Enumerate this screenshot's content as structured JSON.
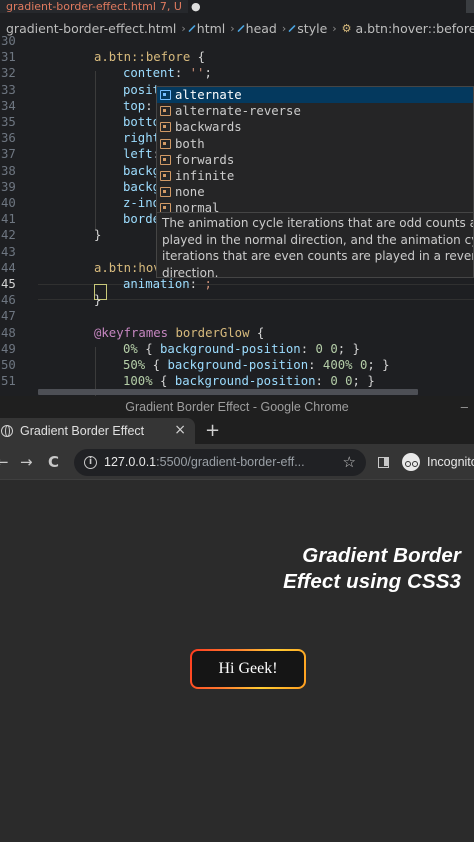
{
  "editor": {
    "tab": {
      "filename": "gradient-border-effect.html",
      "git_status": "7, U",
      "dirty_marker": "●"
    },
    "breadcrumbs": [
      "gradient-border-effect.html",
      "html",
      "head",
      "style",
      "a.btn:hover::before"
    ],
    "lines": [
      {
        "n": "30",
        "parts": []
      },
      {
        "n": "31",
        "parts": [
          [
            "sel",
            "a.btn::before"
          ],
          [
            "punc",
            " {"
          ]
        ]
      },
      {
        "n": "32",
        "parts": [
          [
            "prop",
            "content"
          ],
          [
            "punc",
            ": "
          ],
          [
            "str",
            "''"
          ],
          [
            "punc",
            ";"
          ]
        ]
      },
      {
        "n": "33",
        "parts": [
          [
            "prop",
            "posit"
          ]
        ]
      },
      {
        "n": "34",
        "parts": [
          [
            "prop",
            "top"
          ],
          [
            "punc",
            ":"
          ]
        ]
      },
      {
        "n": "35",
        "parts": [
          [
            "prop",
            "botto"
          ]
        ]
      },
      {
        "n": "36",
        "parts": [
          [
            "prop",
            "right"
          ]
        ]
      },
      {
        "n": "37",
        "parts": [
          [
            "prop",
            "left"
          ],
          [
            "punc",
            ":"
          ]
        ]
      },
      {
        "n": "38",
        "parts": [
          [
            "prop",
            "backg"
          ]
        ]
      },
      {
        "n": "39",
        "parts": [
          [
            "prop",
            "backg"
          ]
        ]
      },
      {
        "n": "40",
        "parts": [
          [
            "prop",
            "z-ind"
          ]
        ]
      },
      {
        "n": "41",
        "parts": [
          [
            "prop",
            "borde"
          ]
        ]
      },
      {
        "n": "42",
        "parts": [
          [
            "punc",
            "}"
          ]
        ]
      },
      {
        "n": "43",
        "parts": []
      },
      {
        "n": "44",
        "parts": [
          [
            "sel",
            "a.btn:hov"
          ]
        ]
      },
      {
        "n": "45",
        "parts": [
          [
            "prop",
            "animation"
          ],
          [
            "punc",
            ": "
          ],
          [
            "str",
            ";"
          ]
        ]
      },
      {
        "n": "46",
        "parts": [
          [
            "punc",
            "}"
          ]
        ]
      },
      {
        "n": "47",
        "parts": []
      },
      {
        "n": "48",
        "parts": [
          [
            "at",
            "@keyframes"
          ],
          [
            "punc",
            " "
          ],
          [
            "kw",
            "borderGlow"
          ],
          [
            "punc",
            " {"
          ]
        ]
      },
      {
        "n": "49",
        "parts": [
          [
            "num",
            "0%"
          ],
          [
            "punc",
            " { "
          ],
          [
            "prop",
            "background-position"
          ],
          [
            "punc",
            ": "
          ],
          [
            "num",
            "0 0"
          ],
          [
            "punc",
            "; }"
          ]
        ]
      },
      {
        "n": "50",
        "parts": [
          [
            "num",
            "50%"
          ],
          [
            "punc",
            " { "
          ],
          [
            "prop",
            "background-position"
          ],
          [
            "punc",
            ": "
          ],
          [
            "num",
            "400% 0"
          ],
          [
            "punc",
            "; }"
          ]
        ]
      },
      {
        "n": "51",
        "parts": [
          [
            "num",
            "100%"
          ],
          [
            "punc",
            " { "
          ],
          [
            "prop",
            "background-position"
          ],
          [
            "punc",
            ": "
          ],
          [
            "num",
            "0 0"
          ],
          [
            "punc",
            "; }"
          ]
        ]
      }
    ],
    "suggestions": [
      "alternate",
      "alternate-reverse",
      "backwards",
      "both",
      "forwards",
      "infinite",
      "none",
      "normal"
    ],
    "suggestion_doc": [
      "The animation cycle iterations that are odd counts a",
      "played in the normal direction, and the animation cy",
      "iterations that are even counts are played in a rever",
      "direction."
    ]
  },
  "browser": {
    "window_title": "Gradient Border Effect - Google Chrome",
    "minimize_glyph": "–",
    "tab_title": "Gradient Border Effect",
    "close_glyph": "×",
    "new_tab_glyph": "+",
    "back_glyph": "←",
    "forward_glyph": "→",
    "reload_glyph": "C",
    "info_glyph": "i",
    "url_host": "127.0.0.1",
    "url_rest": ":5500/gradient-border-eff...",
    "star_glyph": "☆",
    "incognito_label": "Incognito"
  },
  "page": {
    "heading_line1": "Gradient Border",
    "heading_line2": "Effect using CSS3",
    "button_label": "Hi Geek!"
  },
  "colors": {
    "editor_bg": "#1e1f22",
    "suggest_active": "#04395e",
    "gradient_start": "#ff3b1f",
    "gradient_end": "#ffcc33"
  }
}
